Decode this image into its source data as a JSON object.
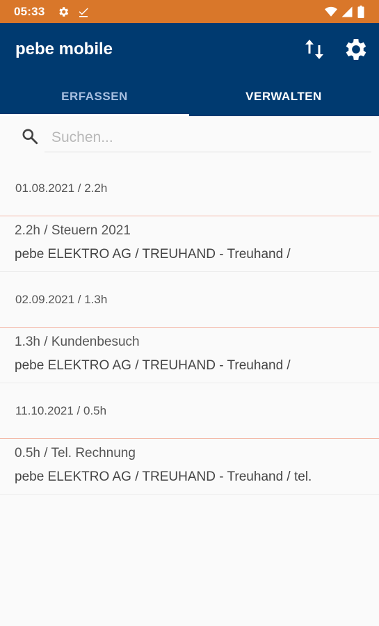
{
  "statusbar": {
    "time": "05:33",
    "icons": [
      "settings-icon",
      "download-done-icon",
      "wifi-icon",
      "signal-icon",
      "battery-icon"
    ]
  },
  "colors": {
    "statusbar": "#d9772a",
    "appbar": "#003a70",
    "divider": "#f3b9a8"
  },
  "appbar": {
    "title": "pebe mobile",
    "actions": [
      "sync-arrows-icon",
      "settings-icon"
    ]
  },
  "tabs": [
    {
      "label": "ERFASSEN",
      "active": false
    },
    {
      "label": "VERWALTEN",
      "active": true
    }
  ],
  "search": {
    "value": "",
    "placeholder": "Suchen..."
  },
  "groups": [
    {
      "header": "01.08.2021 / 2.2h",
      "entries": [
        {
          "title": "2.2h / Steuern 2021",
          "subtitle": "pebe ELEKTRO AG / TREUHAND - Treuhand /"
        }
      ]
    },
    {
      "header": "02.09.2021 / 1.3h",
      "entries": [
        {
          "title": "1.3h / Kundenbesuch",
          "subtitle": "pebe ELEKTRO AG / TREUHAND - Treuhand /"
        }
      ]
    },
    {
      "header": "11.10.2021 / 0.5h",
      "entries": [
        {
          "title": "0.5h / Tel. Rechnung",
          "subtitle": "pebe ELEKTRO AG / TREUHAND - Treuhand / tel."
        }
      ]
    }
  ]
}
